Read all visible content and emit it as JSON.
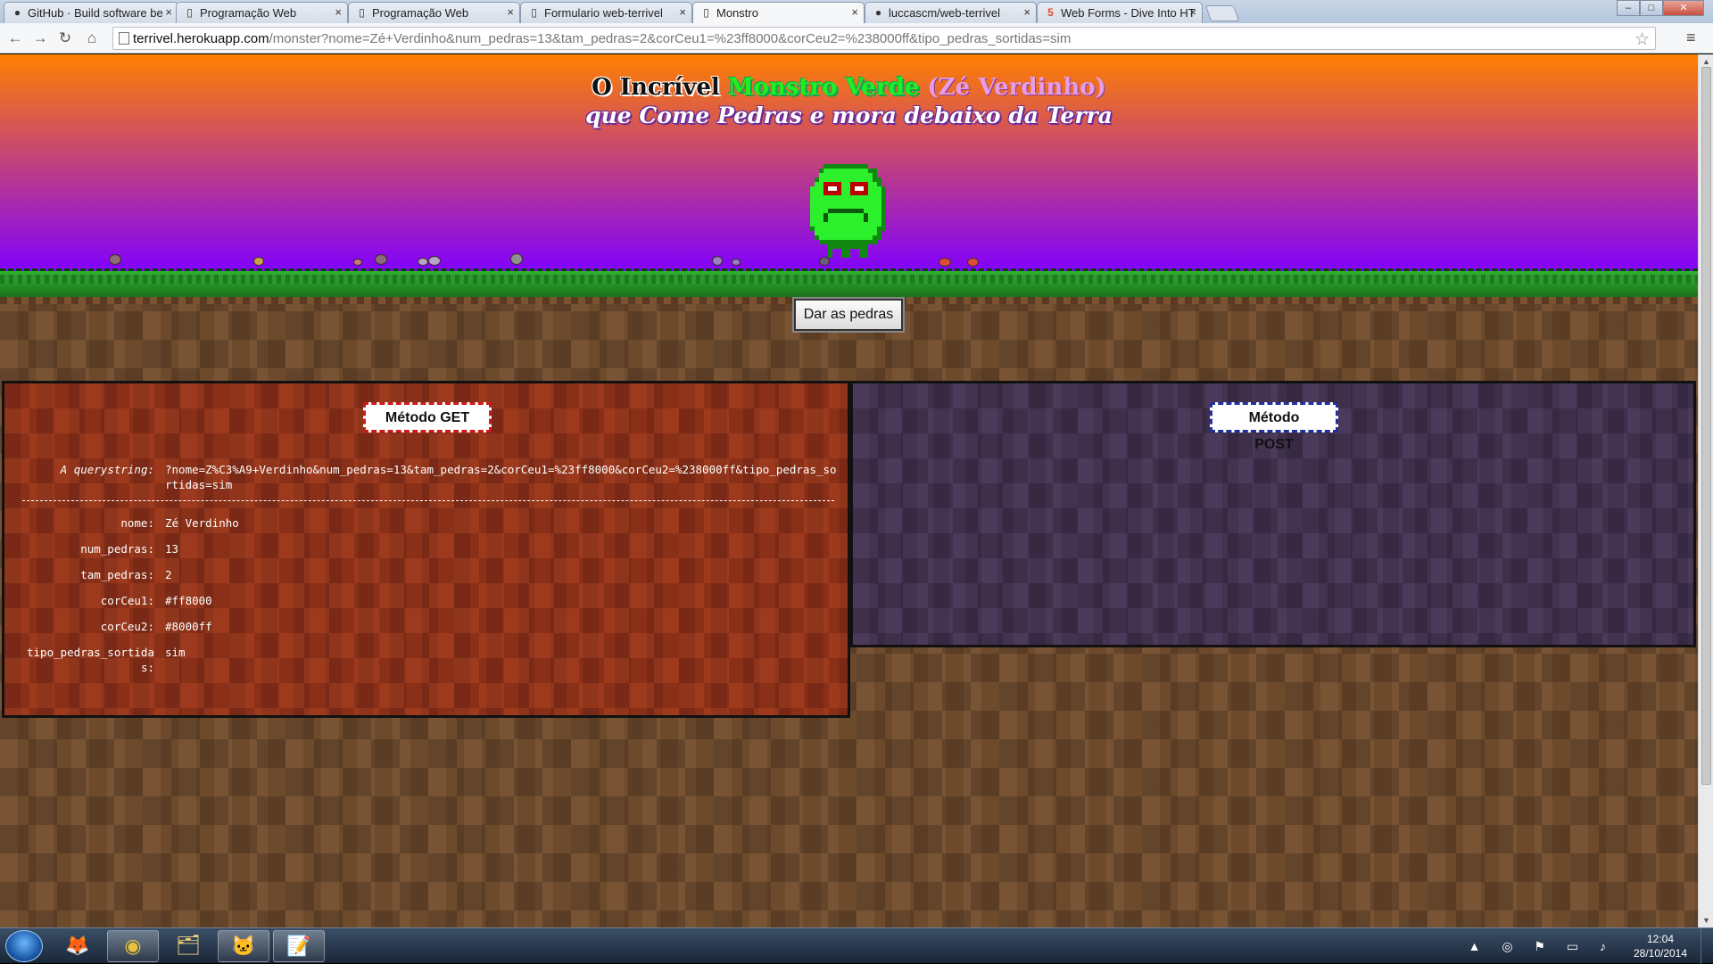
{
  "browser": {
    "tabs": [
      {
        "title": "GitHub · Build software be",
        "icon": "github-icon"
      },
      {
        "title": "Programação Web",
        "icon": "page-icon"
      },
      {
        "title": "Programação Web",
        "icon": "page-icon"
      },
      {
        "title": "Formulario web-terrivel",
        "icon": "page-icon"
      },
      {
        "title": "Monstro",
        "icon": "page-icon",
        "active": true
      },
      {
        "title": "luccascm/web-terrivel",
        "icon": "github-icon"
      },
      {
        "title": "Web Forms - Dive Into HT",
        "icon": "html5-icon"
      }
    ],
    "url_host": "terrivel.herokuapp.com",
    "url_path": "/monster?nome=Zé+Verdinho&num_pedras=13&tam_pedras=2&corCeu1=%23ff8000&corCeu2=%238000ff&tipo_pedras_sortidas=sim"
  },
  "page": {
    "title_prefix": "O Incrível",
    "title_monster": "Monstro Verde",
    "title_name": "(Zé Verdinho)",
    "subtitle": "que Come Pedras e mora debaixo da Terra",
    "feed_button": "Dar as pedras",
    "sky_colors": {
      "top": "#ff8000",
      "bottom": "#8000ff"
    },
    "get_panel": {
      "title": "Método GET",
      "querystring_label": "A querystring:",
      "querystring_value": "?nome=Z%C3%A9+Verdinho&num_pedras=13&tam_pedras=2&corCeu1=%23ff8000&corCeu2=%238000ff&tipo_pedras_sortidas=sim",
      "params": [
        {
          "key": "nome:",
          "value": "Zé Verdinho"
        },
        {
          "key": "num_pedras:",
          "value": "13"
        },
        {
          "key": "tam_pedras:",
          "value": "2"
        },
        {
          "key": "corCeu1:",
          "value": "#ff8000"
        },
        {
          "key": "corCeu2:",
          "value": "#8000ff"
        },
        {
          "key": "tipo_pedras_sortidas:",
          "value": "sim"
        }
      ]
    },
    "post_panel": {
      "title": "Método POST"
    }
  },
  "taskbar": {
    "apps": [
      {
        "name": "firefox-icon",
        "glyph": "🦊",
        "open": false
      },
      {
        "name": "chrome-icon",
        "glyph": "◉",
        "open": true
      },
      {
        "name": "file-explorer-icon",
        "glyph": "🗂",
        "open": false
      },
      {
        "name": "github-desktop-icon",
        "glyph": "🐱",
        "open": true
      },
      {
        "name": "notepad-plus-icon",
        "glyph": "📝",
        "open": true
      }
    ],
    "time": "12:04",
    "date": "28/10/2014"
  }
}
